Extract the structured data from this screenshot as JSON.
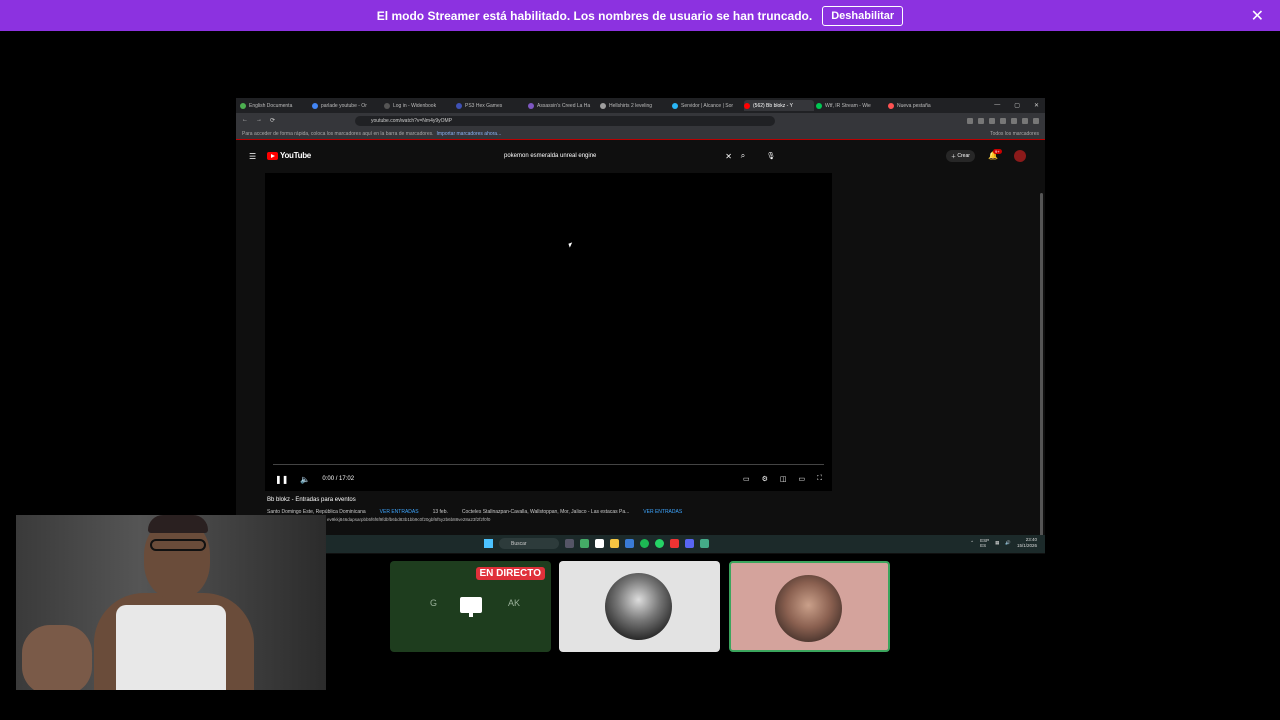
{
  "banner": {
    "message": "El modo Streamer está habilitado. Los nombres de usuario se han truncado.",
    "button_label": "Deshabilitar",
    "bg_color": "#8c32e0"
  },
  "browser": {
    "tabs": [
      {
        "label": "English Documenta",
        "color": "#4caf50"
      },
      {
        "label": "parlade youtube - Or",
        "color": "#4285f4"
      },
      {
        "label": "Log in - Widenbook",
        "color": "#555555"
      },
      {
        "label": "PS3 Hex Games",
        "color": "#3f51b5"
      },
      {
        "label": "Assassin's Creed La Ha",
        "color": "#7e57c2"
      },
      {
        "label": "Hellshirts 2 leveling",
        "color": "#9e9e9e"
      },
      {
        "label": "Servidor | Alcance | Sor",
        "color": "#29b6f6"
      },
      {
        "label": "(562) Bb blokz - Y",
        "color": "#ff0000",
        "active": true
      },
      {
        "label": "Wtf, IR Stream - Wie",
        "color": "#00c853"
      },
      {
        "label": "Nueva pestaña",
        "color": "#ff5252"
      }
    ],
    "url": "youtube.com/watch?v=Nm4y9yOMP",
    "bookmarks_hint": "Para acceder de forma rápida, coloca los marcadores aquí en la barra de marcadores.",
    "bookmarks_link": "Importar marcadores ahora...",
    "all_bookmarks": "Todos los marcadores"
  },
  "youtube": {
    "logo": "YouTube",
    "search_query": "pokemon esmeralda unreal engine",
    "create_label": "Crear",
    "notif_count": "9+",
    "time": "0:00 / 17:02",
    "video_title": "Bb blokz - Entradas para eventos",
    "info_location": "Santo Domingo Este, República Dominicana",
    "info_tickets": "VER ENTRADAS",
    "info_date": "13 feb.",
    "info_venue": "Cocteles Stallnazpan-Cavalla, Wallstoppan, Mor, Jalisco - Las estacas Pa...",
    "info_more": "VER ENTRADAS",
    "hash": "ev9kkj846dapsarpbb5f6f6f9fdbfb6bd83b1bb9c0f20gbf6f5y2b6b88ve28a23f2f2f0f0"
  },
  "taskbar": {
    "search_label": "Buscar",
    "lang": "ESP\nES",
    "time": "23:40",
    "date": "15/1/2026"
  },
  "tiles": {
    "live_label": "EN DIRECTO",
    "stream_letters": [
      "G",
      "AK"
    ]
  }
}
